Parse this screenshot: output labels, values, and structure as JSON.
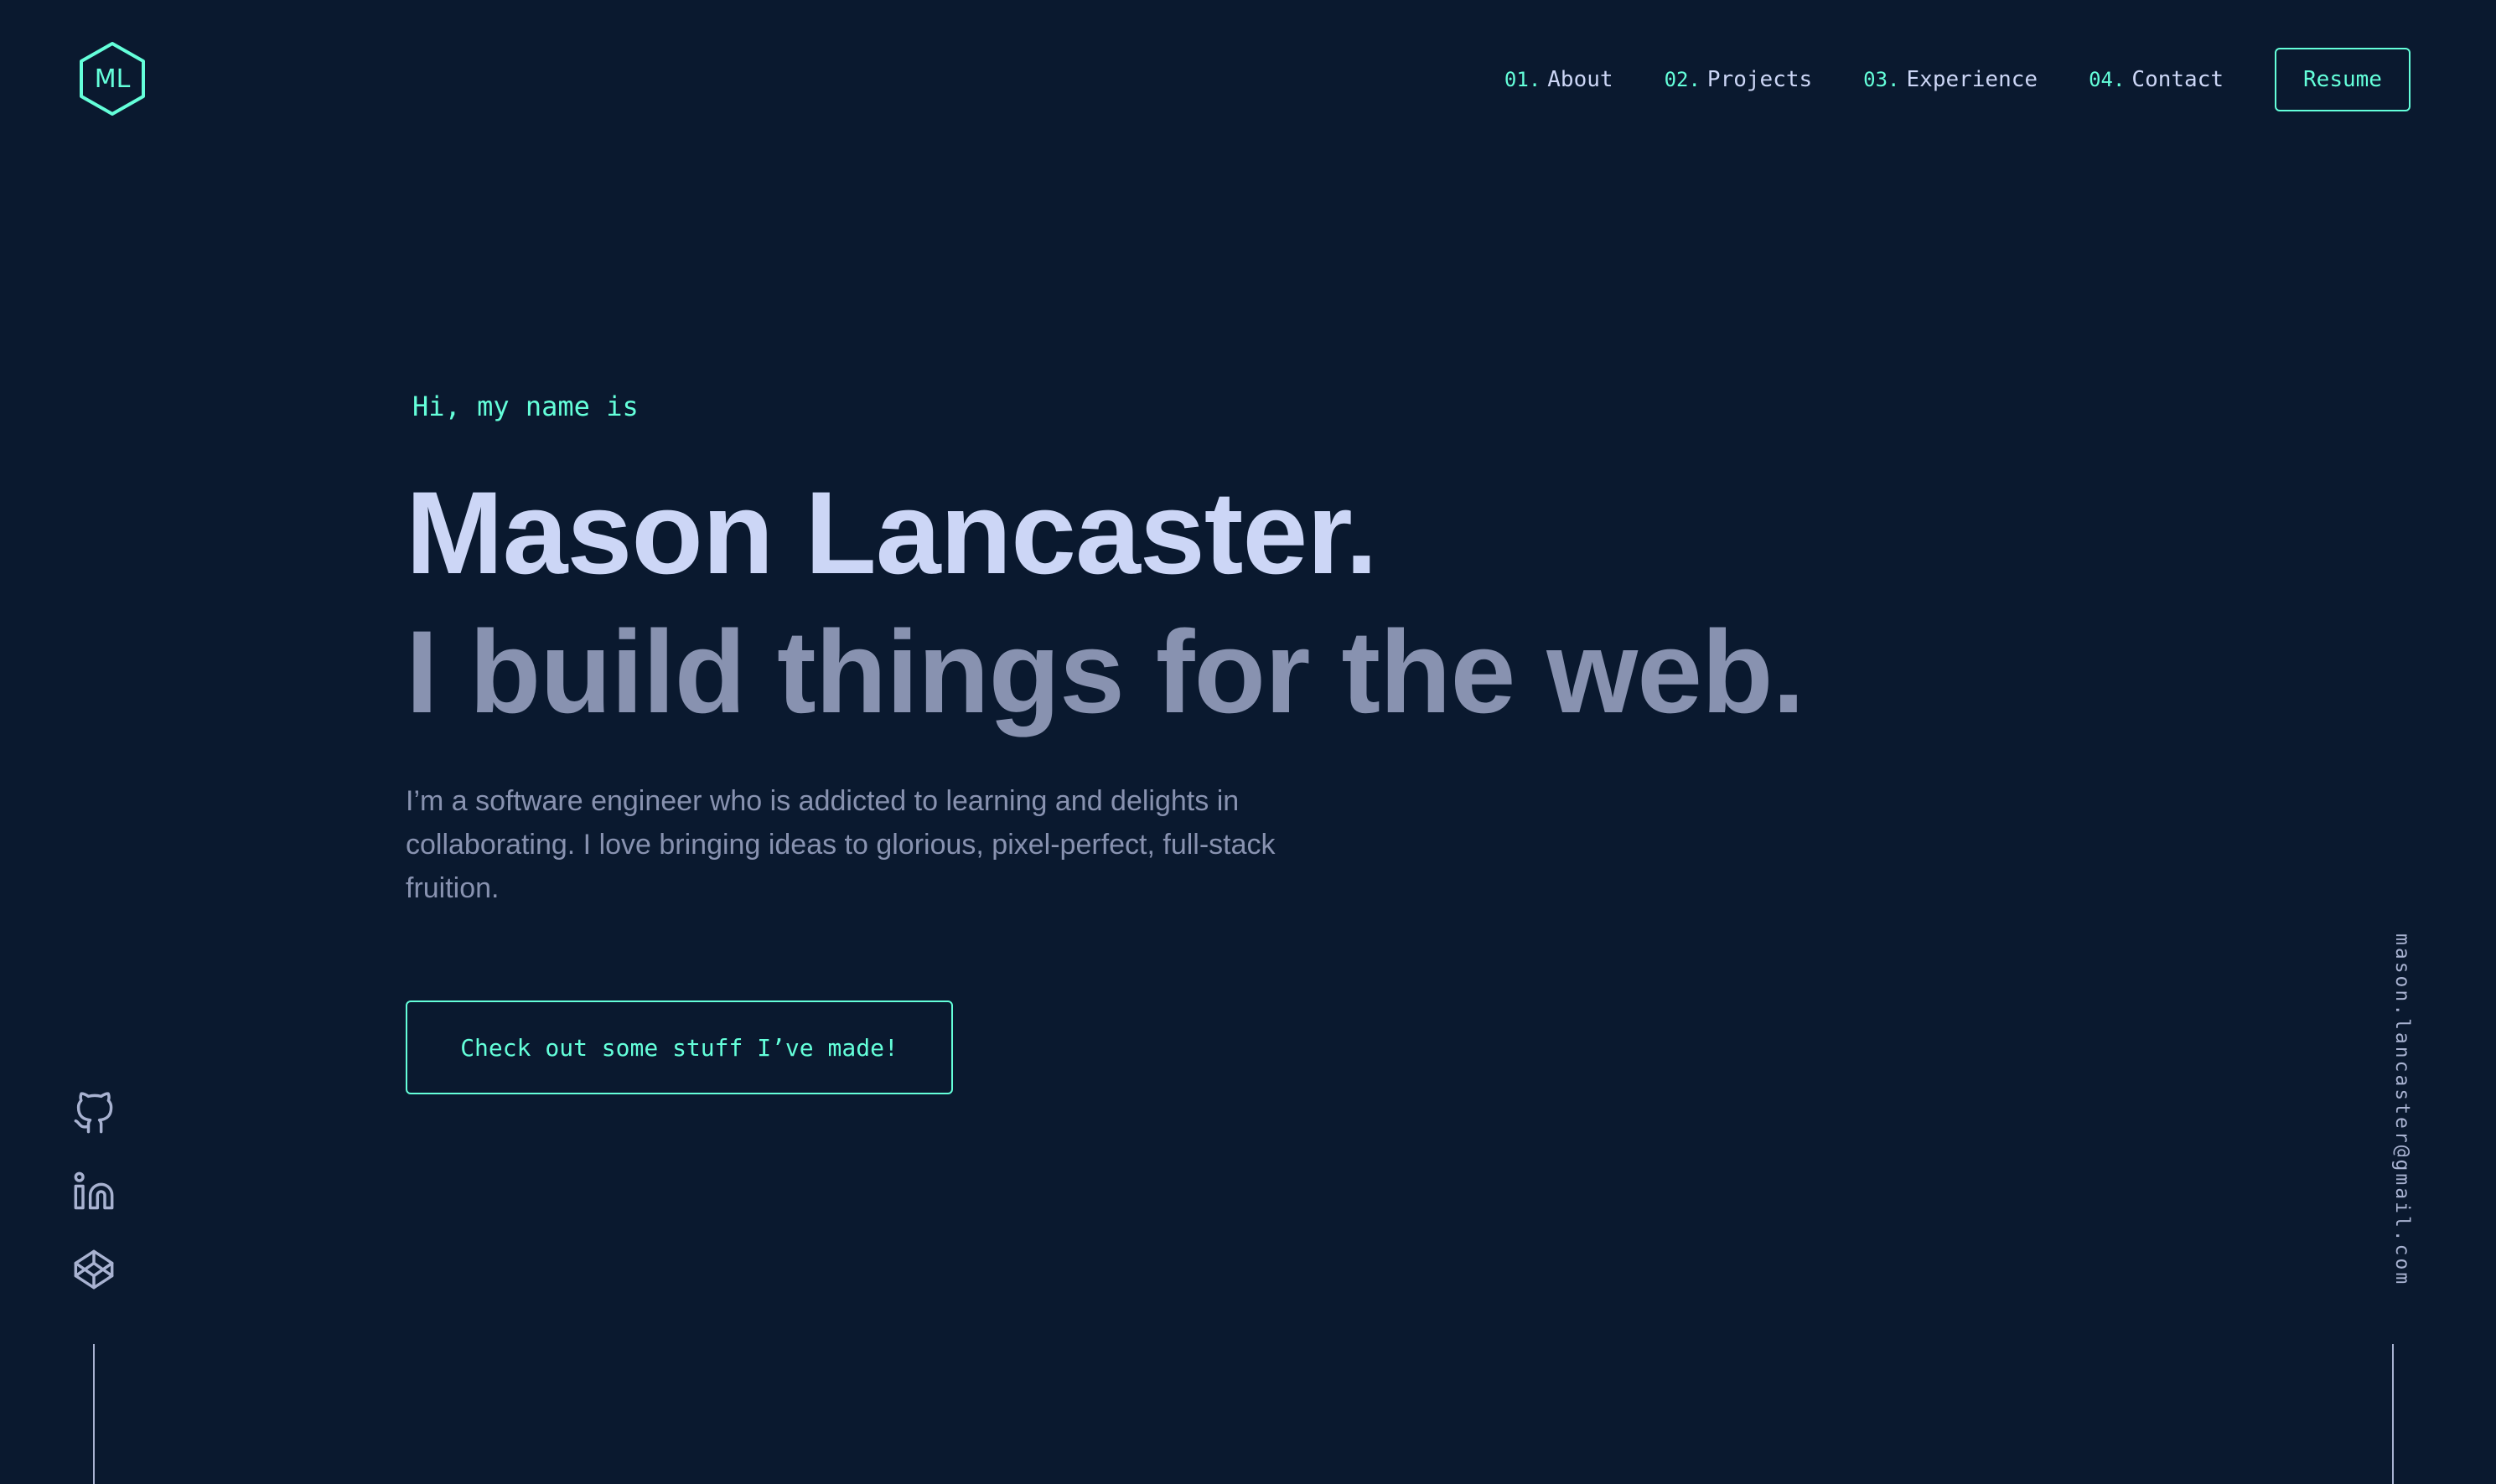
{
  "header": {
    "logo_text": "ML",
    "nav": [
      {
        "num": "01.",
        "label": "About"
      },
      {
        "num": "02.",
        "label": "Projects"
      },
      {
        "num": "03.",
        "label": "Experience"
      },
      {
        "num": "04.",
        "label": "Contact"
      }
    ],
    "resume_label": "Resume"
  },
  "hero": {
    "greeting": "Hi, my name is",
    "name": "Mason Lancaster.",
    "tagline": "I build things for the web.",
    "intro": "I’m a software engineer who is addicted to learning and delights in collaborating. I love bringing ideas to glorious, pixel-perfect, full-stack fruition.",
    "cta_label": "Check out some stuff I’ve made!"
  },
  "social": {
    "icons": [
      "github-icon",
      "linkedin-icon",
      "codepen-icon"
    ]
  },
  "email": "mason.lancaster@gmail.com",
  "colors": {
    "background": "#0a192f",
    "accent": "#64ffda",
    "lightest_slate": "#ccd6f6",
    "slate": "#8892b0",
    "light_slate": "#a8b2d1"
  }
}
